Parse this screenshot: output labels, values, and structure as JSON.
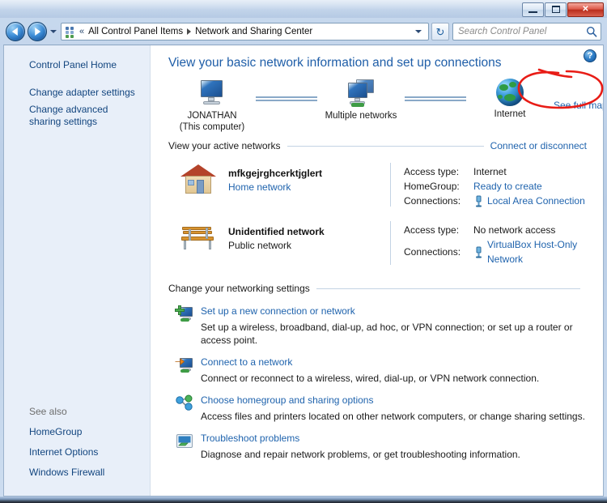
{
  "window": {
    "minimize_label": "Minimize",
    "maximize_label": "Maximize",
    "close_label": "Close"
  },
  "addressbar": {
    "back_label": "Back",
    "forward_label": "Forward",
    "recent_pages_label": "Recent pages",
    "chevrons": "«",
    "crumbs": [
      "All Control Panel Items",
      "Network and Sharing Center"
    ],
    "refresh_label": "Refresh",
    "icon": "control-panel-icon"
  },
  "search": {
    "placeholder": "Search Control Panel",
    "value": "",
    "icon": "search-icon"
  },
  "sidebar": {
    "home_label": "Control Panel Home",
    "items": [
      {
        "label": "Change adapter settings"
      },
      {
        "label": "Change advanced sharing settings"
      }
    ],
    "see_also_label": "See also",
    "see_also_items": [
      {
        "label": "HomeGroup"
      },
      {
        "label": "Internet Options"
      },
      {
        "label": "Windows Firewall"
      }
    ]
  },
  "content": {
    "help_label": "?",
    "heading": "View your basic network information and set up connections",
    "map": {
      "nodes": [
        {
          "name": "JONATHAN",
          "sub": "(This computer)",
          "icon": "computer-icon"
        },
        {
          "name": "Multiple networks",
          "sub": "",
          "icon": "multiple-networks-icon"
        },
        {
          "name": "Internet",
          "sub": "",
          "icon": "globe-icon"
        }
      ],
      "see_full_map": "See full map"
    },
    "active_networks": {
      "title": "View your active networks",
      "link": "Connect or disconnect",
      "rows": [
        {
          "icon": "house-icon",
          "name": "mfkgejrghcerktjglert",
          "sub": "Home network",
          "sub_is_link": true,
          "props": [
            {
              "key": "Access type:",
              "value": "Internet",
              "link": false,
              "icon": ""
            },
            {
              "key": "HomeGroup:",
              "value": "Ready to create",
              "link": true,
              "icon": ""
            },
            {
              "key": "Connections:",
              "value": "Local Area Connection",
              "link": true,
              "icon": "network-plug-icon"
            }
          ]
        },
        {
          "icon": "bench-icon",
          "name": "Unidentified network",
          "sub": "Public network",
          "sub_is_link": false,
          "props": [
            {
              "key": "Access type:",
              "value": "No network access",
              "link": false,
              "icon": ""
            },
            {
              "key": "Connections:",
              "value": "VirtualBox Host-Only Network",
              "link": true,
              "icon": "network-plug-icon"
            }
          ]
        }
      ]
    },
    "settings": {
      "title": "Change your networking settings",
      "tasks": [
        {
          "icon": "new-connection-icon",
          "title": "Set up a new connection or network",
          "desc": "Set up a wireless, broadband, dial-up, ad hoc, or VPN connection; or set up a router or access point."
        },
        {
          "icon": "connect-network-icon",
          "title": "Connect to a network",
          "desc": "Connect or reconnect to a wireless, wired, dial-up, or VPN network connection."
        },
        {
          "icon": "homegroup-icon",
          "title": "Choose homegroup and sharing options",
          "desc": "Access files and printers located on other network computers, or change sharing settings."
        },
        {
          "icon": "troubleshoot-icon",
          "title": "Troubleshoot problems",
          "desc": "Diagnose and repair network problems, or get troubleshooting information."
        }
      ]
    }
  },
  "annotation": {
    "type": "hand-drawn-ellipse",
    "color": "#e81c16",
    "target": "See full map"
  }
}
